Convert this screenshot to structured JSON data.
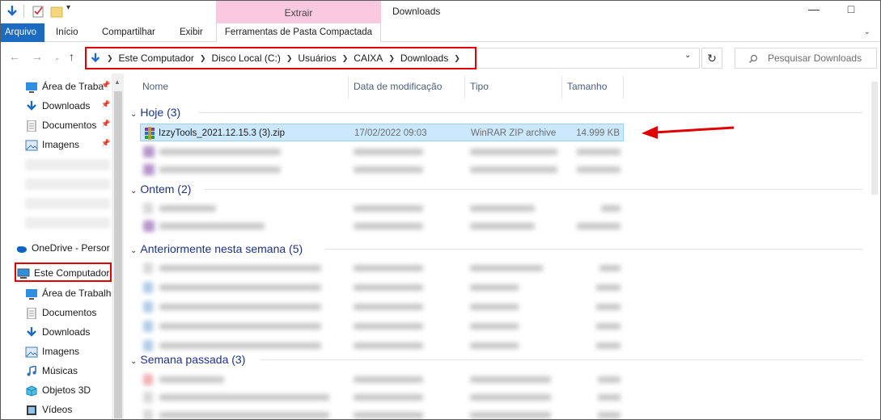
{
  "title_bar": {
    "context_group": "Extrair",
    "window_title": "Downloads"
  },
  "ribbon": {
    "tabs": [
      {
        "label": "Arquivo"
      },
      {
        "label": "Início"
      },
      {
        "label": "Compartilhar"
      },
      {
        "label": "Exibir"
      },
      {
        "label": "Ferramentas de Pasta Compactada"
      }
    ]
  },
  "address": {
    "crumbs": [
      "Este Computador",
      "Disco Local (C:)",
      "Usuários",
      "CAIXA",
      "Downloads"
    ],
    "search_placeholder": "Pesquisar Downloads"
  },
  "nav_pane": {
    "quick_access": [
      {
        "label": "Área de Traba",
        "icon": "desktop-icon",
        "pinned": true
      },
      {
        "label": "Downloads",
        "icon": "download-icon",
        "pinned": true
      },
      {
        "label": "Documentos",
        "icon": "documents-icon",
        "pinned": true
      },
      {
        "label": "Imagens",
        "icon": "images-icon",
        "pinned": true
      }
    ],
    "onedrive": "OneDrive - Persor",
    "this_pc": "Este Computador",
    "this_pc_children": [
      {
        "label": "Área de Trabalho",
        "icon": "desktop-icon"
      },
      {
        "label": "Documentos",
        "icon": "documents-icon"
      },
      {
        "label": "Downloads",
        "icon": "download-icon"
      },
      {
        "label": "Imagens",
        "icon": "images-icon"
      },
      {
        "label": "Músicas",
        "icon": "music-icon"
      },
      {
        "label": "Objetos 3D",
        "icon": "cube-icon"
      },
      {
        "label": "Vídeos",
        "icon": "video-icon"
      }
    ]
  },
  "file_list": {
    "columns": [
      "Nome",
      "Data de modificação",
      "Tipo",
      "Tamanho"
    ],
    "groups": [
      {
        "label": "Hoje (3)"
      },
      {
        "label": "Ontem (2)"
      },
      {
        "label": "Anteriormente nesta semana (5)"
      },
      {
        "label": "Semana passada (3)"
      }
    ],
    "selected_file": {
      "name": "IzzyTools_2021.12.15.3 (3).zip",
      "date": "17/02/2022 09:03",
      "type": "WinRAR ZIP archive",
      "size": "14.999 KB"
    }
  },
  "colors": {
    "accent": "#1a6bc1",
    "highlight_box": "#e00000",
    "context_tab": "#f9c9e0",
    "selection": "#cce8ff"
  }
}
